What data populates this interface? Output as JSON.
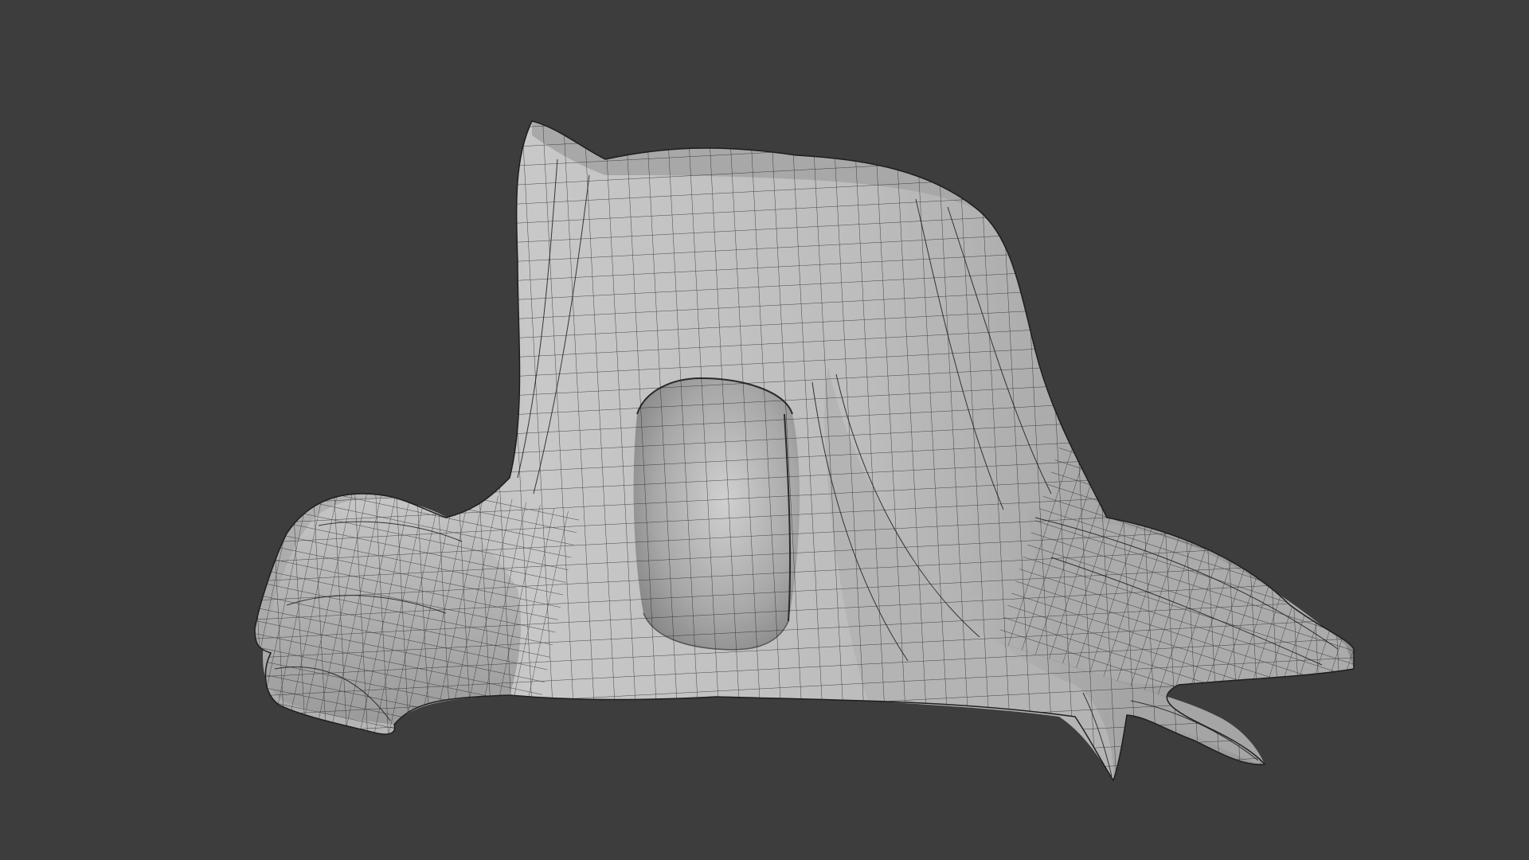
{
  "viewport": {
    "background_color": "#3d3d3d",
    "shading": "solid",
    "overlay": "wireframe"
  },
  "model": {
    "subject": "tree-stump-with-hollow-and-roots",
    "surface_color": "#bdbdbd",
    "wire_color": "#1b1b1b"
  }
}
